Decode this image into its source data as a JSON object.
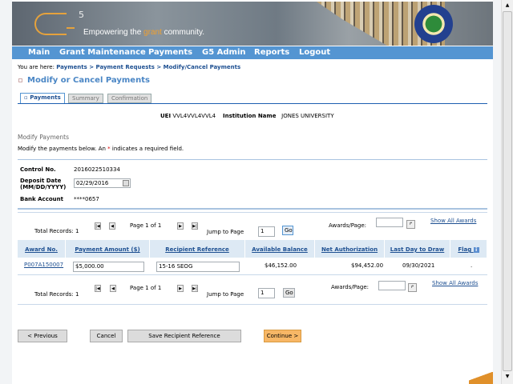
{
  "header": {
    "logo": "G5",
    "tagline_pre": "Empowering the ",
    "tagline_accent": "grant",
    "tagline_post": " community.",
    "seal": "Department of Education"
  },
  "nav": [
    "Main",
    "Grant Maintenance",
    "Payments",
    "G5 Admin",
    "Reports",
    "Logout"
  ],
  "breadcrumb": {
    "prefix": "You are here:",
    "items": [
      "Payments",
      "Payment Requests",
      "Modify/Cancel Payments"
    ],
    "sep": " > "
  },
  "page_title": "Modify or Cancel Payments",
  "tabs": [
    "Payments",
    "Summary",
    "Confirmation"
  ],
  "info": {
    "uei_label": "UEI",
    "uei": "VVL4VVL4VVL4",
    "inst_label": "Institution Name",
    "inst": "JONES UNIVERSITY"
  },
  "section_title": "Modify Payments",
  "instructions": {
    "pre": "Modify the payments below. An ",
    "star": "*",
    "post": " indicates a required field."
  },
  "form": {
    "control_label": "Control No.",
    "control": "2016022510334",
    "deposit_label1": "Deposit Date",
    "deposit_label2": "(MM/DD/YYYY)",
    "deposit": "02/29/2016",
    "bank_label": "Bank Account",
    "bank": "****0657"
  },
  "pagination": {
    "total": "Total Records: 1",
    "page": "Page 1 of 1",
    "jump": "Jump to Page",
    "jump_value": "1",
    "go": "Go",
    "awards_per_page": "Awards/Page:",
    "show_all": "Show All Awards"
  },
  "table": {
    "columns": [
      "Award No.",
      "Payment Amount ($)",
      "Recipient Reference",
      "Available Balance",
      "Net Authorization",
      "Last Day to Draw",
      "Flag"
    ],
    "rows": [
      {
        "award": "P007A150007",
        "amount": "$5,000.00",
        "reference": "15-16 SEOG",
        "available": "$46,152.00",
        "net": "$94,452.00",
        "last_day": "09/30/2021",
        "flag": "."
      }
    ]
  },
  "buttons": {
    "previous": "< Previous",
    "cancel": "Cancel",
    "save": "Save Recipient Reference",
    "continue": "Continue >"
  }
}
